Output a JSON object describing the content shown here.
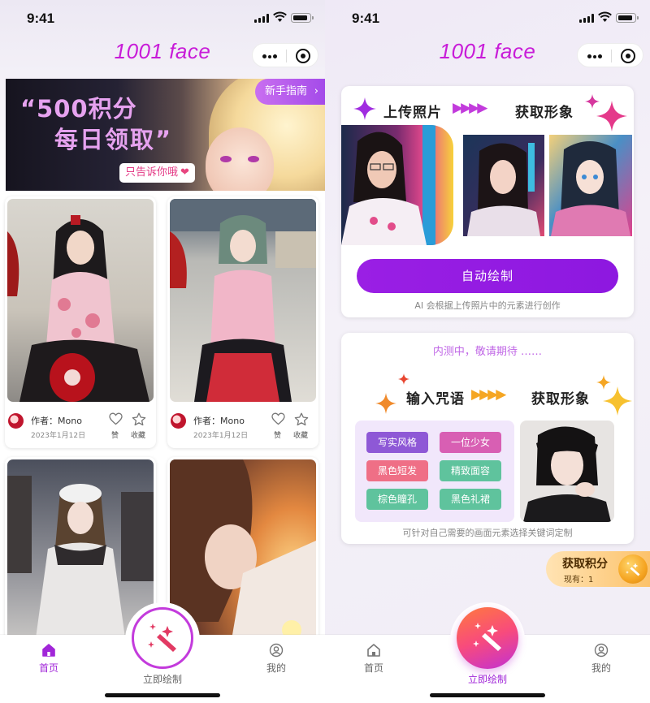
{
  "left_screen": {
    "status": {
      "time": "9:41"
    },
    "app_title": "1001 face",
    "banner": {
      "line1": "“500积分",
      "line2": "每日领取”",
      "tag": "只告诉你哦",
      "guide_label": "新手指南"
    },
    "cards": [
      {
        "author": "作者：Mono",
        "date": "2023年1月12日",
        "like_label": "赞",
        "fav_label": "收藏"
      },
      {
        "author": "作者：Mono",
        "date": "2023年1月12日",
        "like_label": "赞",
        "fav_label": "收藏"
      }
    ],
    "tabbar": {
      "home": "首页",
      "draw": "立即绘制",
      "mine": "我的",
      "active": "home"
    }
  },
  "right_screen": {
    "status": {
      "time": "9:41"
    },
    "app_title": "1001 face",
    "auto_panel": {
      "upload_label": "上传照片",
      "result_label": "获取形象",
      "button": "自动绘制",
      "hint": "AI 会根据上传照片中的元素进行创作"
    },
    "prompt_panel": {
      "notice": "内测中，敬请期待 ……",
      "prompt_label": "输入咒语",
      "result_label": "获取形象",
      "keywords": [
        {
          "label": "写实风格",
          "color": "#8e58d6"
        },
        {
          "label": "一位少女",
          "color": "#d85fb3"
        },
        {
          "label": "黑色短发",
          "color": "#ef6f86"
        },
        {
          "label": "精致面容",
          "color": "#5fc39d"
        },
        {
          "label": "棕色瞳孔",
          "color": "#5fc39d"
        },
        {
          "label": "黑色礼裙",
          "color": "#5fc39d"
        }
      ],
      "hint": "可针对自己需要的画面元素选择关键词定制"
    },
    "points": {
      "title": "获取积分",
      "count": "现有：1"
    },
    "tabbar": {
      "home": "首页",
      "draw": "立即绘制",
      "mine": "我的",
      "active": "draw"
    }
  },
  "colors": {
    "brand_magenta": "#c81cd8",
    "primary_purple": "#9a1fe4",
    "active_tab": "#a126d8"
  }
}
